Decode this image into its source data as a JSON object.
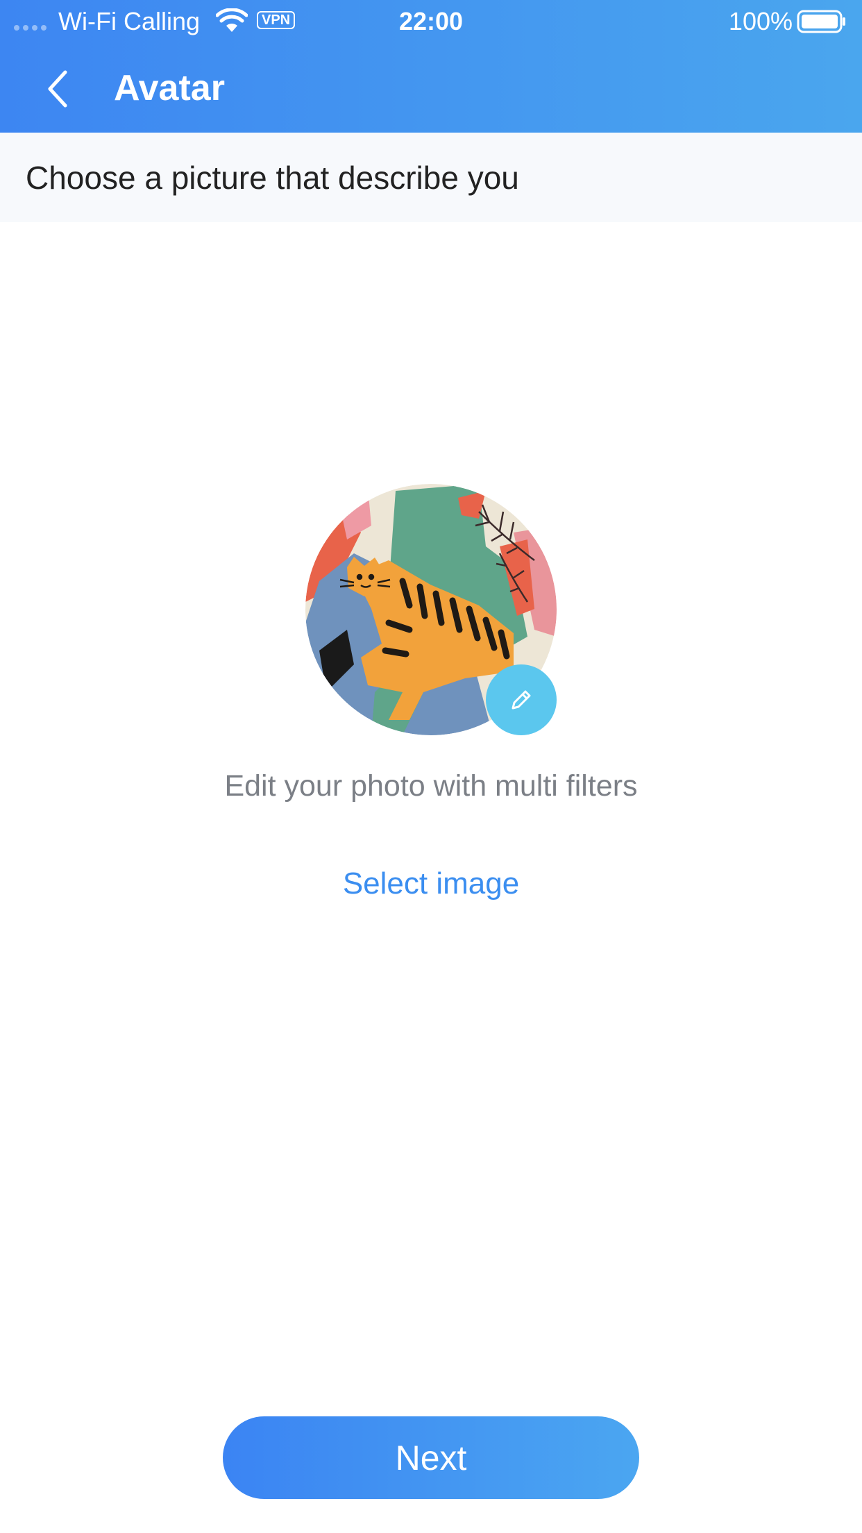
{
  "status_bar": {
    "carrier": "Wi-Fi Calling",
    "vpn": "VPN",
    "time": "22:00",
    "battery": "100%"
  },
  "header": {
    "title": "Avatar",
    "back_icon": "chevron-left-icon",
    "gradient_start": "#3d86f2",
    "gradient_end": "#4aa6ee"
  },
  "subtitle": "Choose a picture that describe you",
  "avatar": {
    "edit_icon": "pencil-icon",
    "edit_color": "#5bc7ee"
  },
  "hint": "Edit your photo with multi filters",
  "select_image": "Select image",
  "next_button": "Next",
  "colors": {
    "accent": "#3b8ef0",
    "hint_text": "#7b7f86"
  }
}
